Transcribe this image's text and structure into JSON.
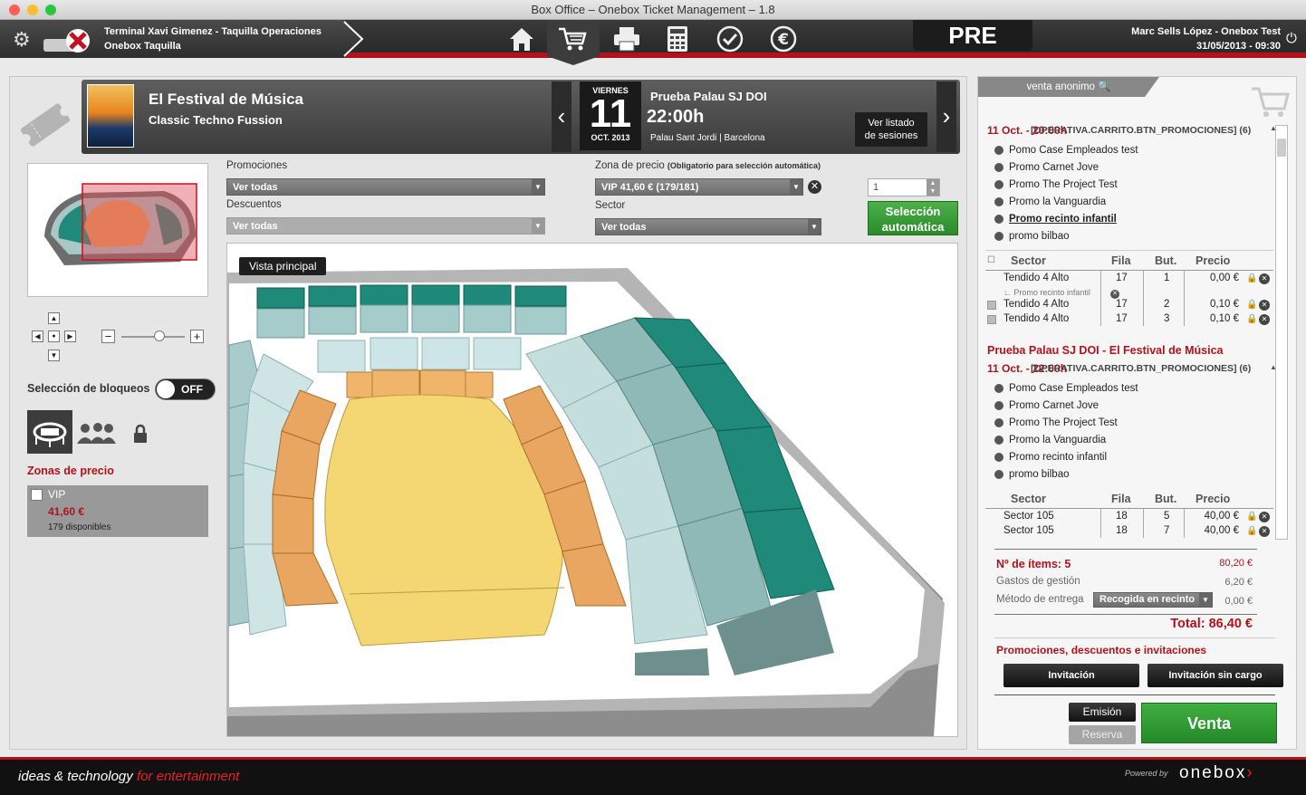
{
  "window": {
    "title": "Box Office – Onebox Ticket Management – 1.8"
  },
  "header": {
    "terminal_line1": "Terminal Xavi Gimenez - Taquilla Operaciones",
    "terminal_line2": "Onebox Taquilla",
    "env_badge": "PRE",
    "user": "Marc Sells López - Onebox Test",
    "datetime": "31/05/2013 - 09:30",
    "nav_icons": [
      "home-icon",
      "cart-icon",
      "printer-icon",
      "calculator-icon",
      "check-icon",
      "euro-icon"
    ]
  },
  "event": {
    "title": "El Festival de Música",
    "subtitle": "Classic Techno Fussion",
    "weekday": "VIERNES",
    "day": "11",
    "month_year": "OCT. 2013",
    "session_name": "Prueba Palau SJ DOI",
    "time": "22:00h",
    "venue": "Palau Sant Jordi | Barcelona",
    "sessions_btn_line1": "Ver listado",
    "sessions_btn_line2": "de sesiones"
  },
  "filters": {
    "promociones_label": "Promociones",
    "promociones_value": "Ver todas",
    "descuentos_label": "Descuentos",
    "descuentos_value": "Ver todas",
    "zona_label": "Zona de precio",
    "zona_note": "(Obligatorio para selección automática)",
    "zona_value": "VIP 41,60 € (179/181)",
    "sector_label": "Sector",
    "sector_value": "Ver todas",
    "qty_value": "1",
    "auto_btn_line1": "Selección",
    "auto_btn_line2": "automática"
  },
  "map": {
    "view_label": "Vista principal",
    "zoom_level": 0.6
  },
  "sidebar": {
    "bloqueos_label": "Selección de bloqueos",
    "toggle_label": "OFF",
    "zonas_title": "Zonas de precio",
    "zone": {
      "name": "VIP",
      "price": "41,60 €",
      "available": "179 disponibles"
    }
  },
  "cart": {
    "tab_label": "venta anonimo",
    "group1": {
      "date_header": "11 Oct. - 20:00h",
      "promo_header": "[OPERATIVA.CARRITO.BTN_PROMOCIONES] (6)",
      "promos": [
        "Pomo Case Empleados test",
        "Promo Carnet Jove",
        "Promo The Project Test",
        "Promo la Vanguardia",
        "Promo recinto infantil",
        "promo bilbao"
      ],
      "cols": [
        "Sector",
        "Fila",
        "But.",
        "Precio"
      ],
      "rows": [
        {
          "sector": "Tendido 4 Alto",
          "fila": "17",
          "but": "1",
          "precio": "0,00 €"
        },
        {
          "sector": "Tendido 4 Alto",
          "fila": "17",
          "but": "2",
          "precio": "0,10 €"
        },
        {
          "sector": "Tendido 4 Alto",
          "fila": "17",
          "but": "3",
          "precio": "0,10 €"
        }
      ],
      "sub_promo": "Promo recinto infantil"
    },
    "group2": {
      "event_header": "Prueba Palau SJ DOI - El Festival de Música",
      "date_header": "11 Oct. - 22:00h",
      "promo_header": "[OPERATIVA.CARRITO.BTN_PROMOCIONES] (6)",
      "promos": [
        "Pomo Case Empleados test",
        "Promo Carnet Jove",
        "Promo The Project Test",
        "Promo la Vanguardia",
        "Promo recinto infantil",
        "promo bilbao"
      ],
      "cols": [
        "Sector",
        "Fila",
        "But.",
        "Precio"
      ],
      "rows": [
        {
          "sector": "Sector 105",
          "fila": "18",
          "but": "5",
          "precio": "40,00 €"
        },
        {
          "sector": "Sector 105",
          "fila": "18",
          "but": "7",
          "precio": "40,00 €"
        }
      ]
    },
    "summary": {
      "items_label": "Nº de ítems: 5",
      "items_amount": "80,20 €",
      "gastos_label": "Gastos de gestión",
      "gastos_amount": "6,20 €",
      "metodo_label": "Método de entrega",
      "metodo_value": "Recogida en recinto",
      "metodo_amount": "0,00 €",
      "total": "Total: 86,40 €"
    },
    "promos_title": "Promociones, descuentos e invitaciones",
    "invitacion": "Invitación",
    "invitacion_sin_cargo": "Invitación sin cargo",
    "emision": "Emisión",
    "reserva": "Reserva",
    "venta": "Venta"
  },
  "footer": {
    "tagline_a": "ideas & technology",
    "tagline_b": "for entertainment",
    "powered": "Powered by",
    "brand": "onebox"
  }
}
